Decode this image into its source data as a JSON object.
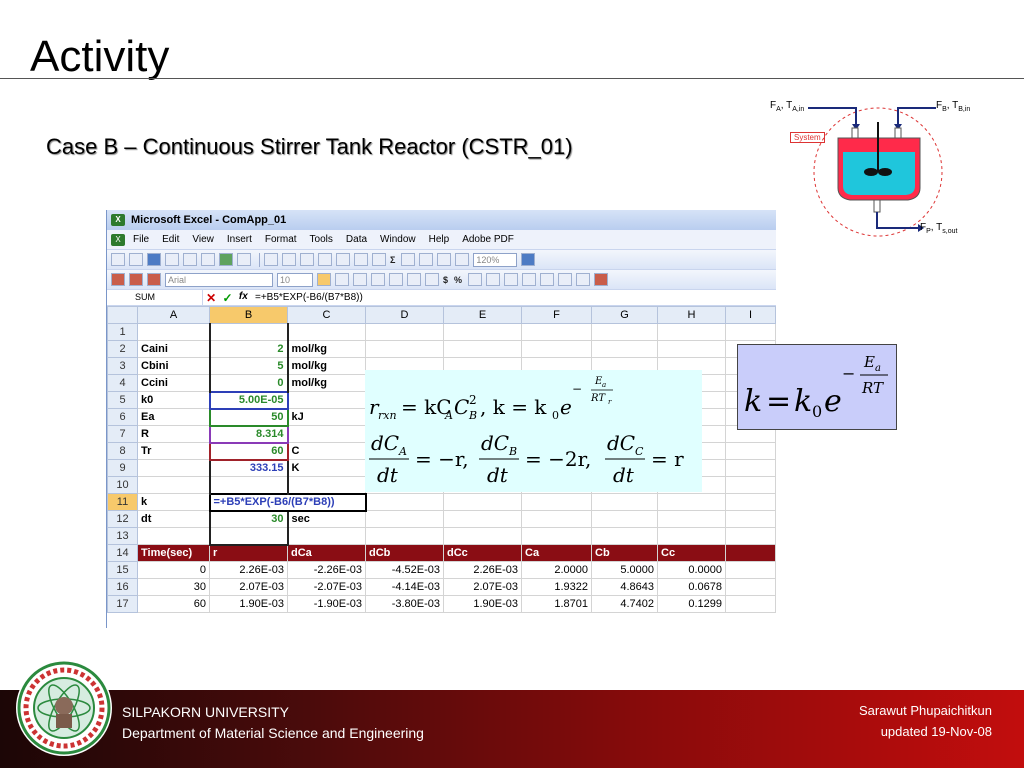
{
  "slide": {
    "title": "Activity",
    "subtitle": "Case B – Continuous Stirrer Tank Reactor (CSTR_01)"
  },
  "reactor": {
    "system_label": "System",
    "feed_a": "F",
    "feed_a_sub": "A",
    "feed_a_t": ", T",
    "feed_a_t_sub": "A,in",
    "feed_b": "F",
    "feed_b_sub": "B",
    "feed_b_t": ", T",
    "feed_b_t_sub": "B,in",
    "product": "F",
    "product_sub": "P",
    "product_t": ", T",
    "product_t_sub": "s,out",
    "colors": {
      "liquid": "#1fc6dc",
      "vessel": "#ff2a4a"
    }
  },
  "excel": {
    "window_title": "Microsoft Excel - ComApp_01",
    "menu": [
      "File",
      "Edit",
      "View",
      "Insert",
      "Format",
      "Tools",
      "Data",
      "Window",
      "Help",
      "Adobe PDF"
    ],
    "zoom": "120%",
    "font_name": "Arial",
    "font_size": "10",
    "name_box": "SUM",
    "formula_bar": "=+B5*EXP(-B6/(B7*B8))",
    "columns": [
      "A",
      "B",
      "C",
      "D",
      "E",
      "F",
      "G",
      "H",
      "I"
    ],
    "rows": [
      {
        "n": "1",
        "a": "",
        "b": "",
        "c": ""
      },
      {
        "n": "2",
        "a": "Caini",
        "b": "2",
        "c": "mol/kg"
      },
      {
        "n": "3",
        "a": "Cbini",
        "b": "5",
        "c": "mol/kg"
      },
      {
        "n": "4",
        "a": "Ccini",
        "b": "0",
        "c": "mol/kg"
      },
      {
        "n": "5",
        "a": "k0",
        "b": "5.00E-05",
        "c": ""
      },
      {
        "n": "6",
        "a": "Ea",
        "b": "50",
        "c": "kJ"
      },
      {
        "n": "7",
        "a": "R",
        "b": "8.314",
        "c": ""
      },
      {
        "n": "8",
        "a": "Tr",
        "b": "60",
        "c": "C"
      },
      {
        "n": "9",
        "a": "",
        "b": "333.15",
        "c": "K"
      },
      {
        "n": "10",
        "a": "",
        "b": "",
        "c": ""
      },
      {
        "n": "11",
        "a": "k",
        "b": "=+B5*EXP(-B6/(B7*B8))",
        "c": ""
      },
      {
        "n": "12",
        "a": "dt",
        "b": "30",
        "c": "sec"
      },
      {
        "n": "13",
        "a": "",
        "b": "",
        "c": ""
      }
    ],
    "table_header": {
      "n": "14",
      "cells": [
        "Time(sec)",
        "r",
        "dCa",
        "dCb",
        "dCc",
        "Ca",
        "Cb",
        "Cc"
      ]
    },
    "table_rows": [
      {
        "n": "15",
        "cells": [
          "0",
          "2.26E-03",
          "-2.26E-03",
          "-4.52E-03",
          "2.26E-03",
          "2.0000",
          "5.0000",
          "0.0000"
        ]
      },
      {
        "n": "16",
        "cells": [
          "30",
          "2.07E-03",
          "-2.07E-03",
          "-4.14E-03",
          "2.07E-03",
          "1.9322",
          "4.8643",
          "0.0678"
        ]
      },
      {
        "n": "17",
        "cells": [
          "60",
          "1.90E-03",
          "-1.90E-03",
          "-3.80E-03",
          "1.90E-03",
          "1.8701",
          "4.7402",
          "0.1299"
        ]
      }
    ]
  },
  "footer": {
    "university": "SILPAKORN UNIVERSITY",
    "department": "Department of Material Science and Engineering",
    "author": "Sarawut Phupaichitkun",
    "updated": "updated  19-Nov-08",
    "colors": {
      "band_dark": "#1c0606",
      "band_bright": "#c20d0d"
    }
  }
}
